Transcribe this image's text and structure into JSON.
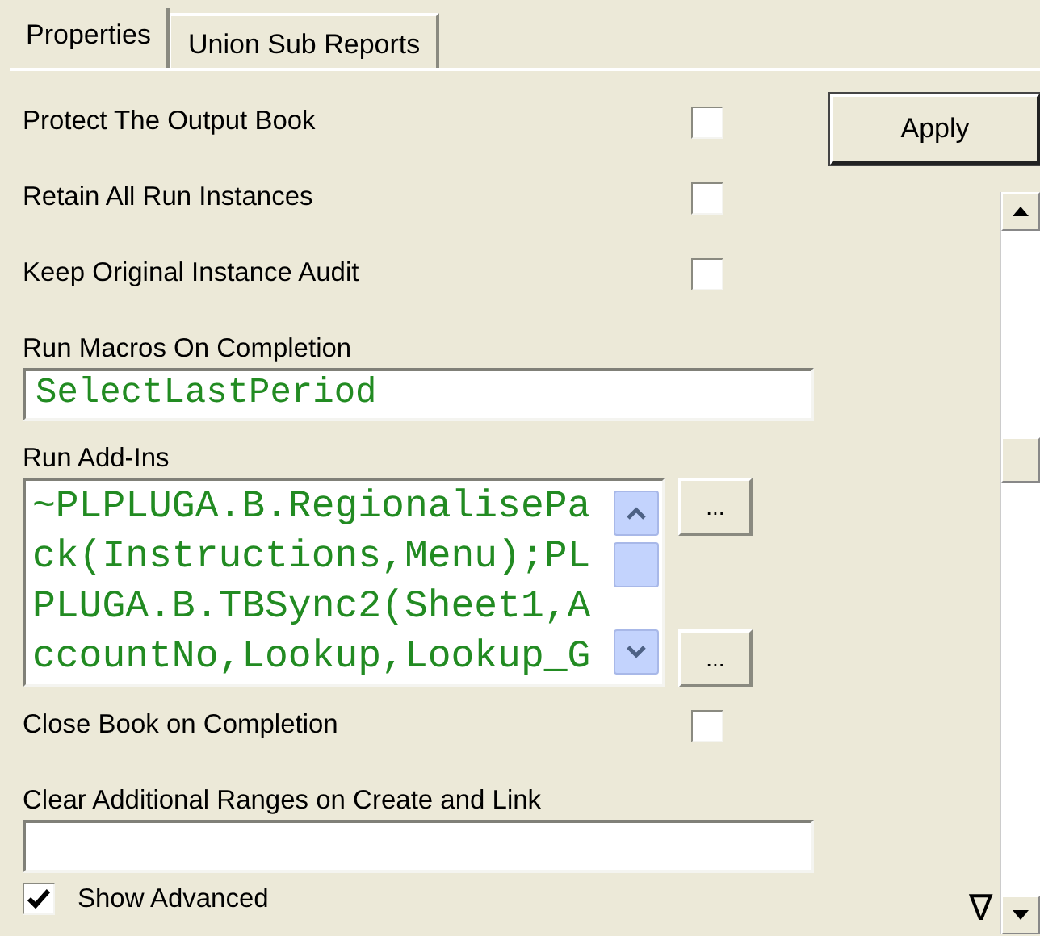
{
  "tabs": [
    {
      "label": "Properties",
      "selected": true
    },
    {
      "label": "Union Sub Reports",
      "selected": false
    }
  ],
  "fields": [
    {
      "kind": "checkbox",
      "label": "Protect The Output Book",
      "checked": false
    },
    {
      "kind": "checkbox",
      "label": "Retain All Run Instances",
      "checked": false
    },
    {
      "kind": "checkbox",
      "label": "Keep Original Instance Audit",
      "checked": false
    },
    {
      "kind": "text",
      "label": "Run Macros On Completion",
      "value": "SelectLastPeriod"
    },
    {
      "kind": "textarea",
      "label": "Run Add-Ins",
      "value": "~PLPLUGA.B.RegionalisePack(Instructions,Menu);PLPLUGA.B.TBSync2(Sheet1,AccountNo,Lookup,Lookup_G",
      "buttons": [
        "...",
        "..."
      ]
    },
    {
      "kind": "checkbox",
      "label": "Close Book on Completion",
      "checked": false
    },
    {
      "kind": "text",
      "label": "Clear Additional Ranges on Create and Link"
    }
  ],
  "show_advanced": {
    "label": "Show Advanced",
    "checked": true
  },
  "apply_button": "Apply",
  "collapse_glyph": "∇"
}
